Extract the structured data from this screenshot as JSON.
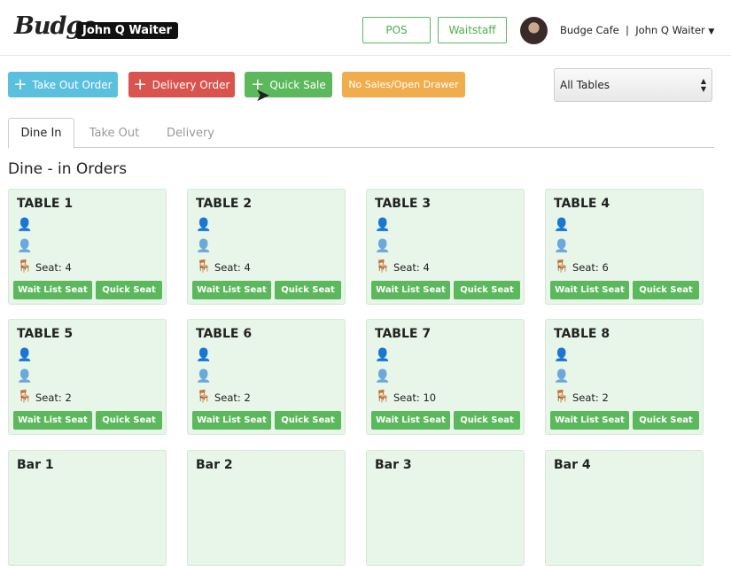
{
  "header": {
    "logo": "Budge",
    "user_badge": "John Q Waiter",
    "pos": "POS",
    "waitstaff": "Waitstaff",
    "account": "Budge Cafe  |  John Q Waiter"
  },
  "actions": {
    "take_out": "Take Out Order",
    "delivery": "Delivery Order",
    "quick_sale": "Quick Sale",
    "no_sales": "No Sales/Open Drawer",
    "table_filter": "All Tables"
  },
  "tabs": [
    "Dine In",
    "Take Out",
    "Delivery"
  ],
  "section_title": "Dine - in Orders",
  "tables": [
    {
      "name": "TABLE 1",
      "seat": "Seat: 4"
    },
    {
      "name": "TABLE 2",
      "seat": "Seat: 4"
    },
    {
      "name": "TABLE 3",
      "seat": "Seat: 4"
    },
    {
      "name": "TABLE 4",
      "seat": "Seat: 6"
    },
    {
      "name": "TABLE 5",
      "seat": "Seat: 2"
    },
    {
      "name": "TABLE 6",
      "seat": "Seat: 2"
    },
    {
      "name": "TABLE 7",
      "seat": "Seat: 10"
    },
    {
      "name": "TABLE 8",
      "seat": "Seat: 2"
    },
    {
      "name": "Bar 1",
      "seat": ""
    },
    {
      "name": "Bar 2",
      "seat": ""
    },
    {
      "name": "Bar 3",
      "seat": ""
    },
    {
      "name": "Bar 4",
      "seat": ""
    }
  ],
  "card_buttons": {
    "wait": "Wait List Seat",
    "quick": "Quick Seat"
  },
  "colors": {
    "blue": "#5bc0de",
    "red": "#d9534f",
    "green": "#5cb85c",
    "orange": "#f0ad4e"
  }
}
